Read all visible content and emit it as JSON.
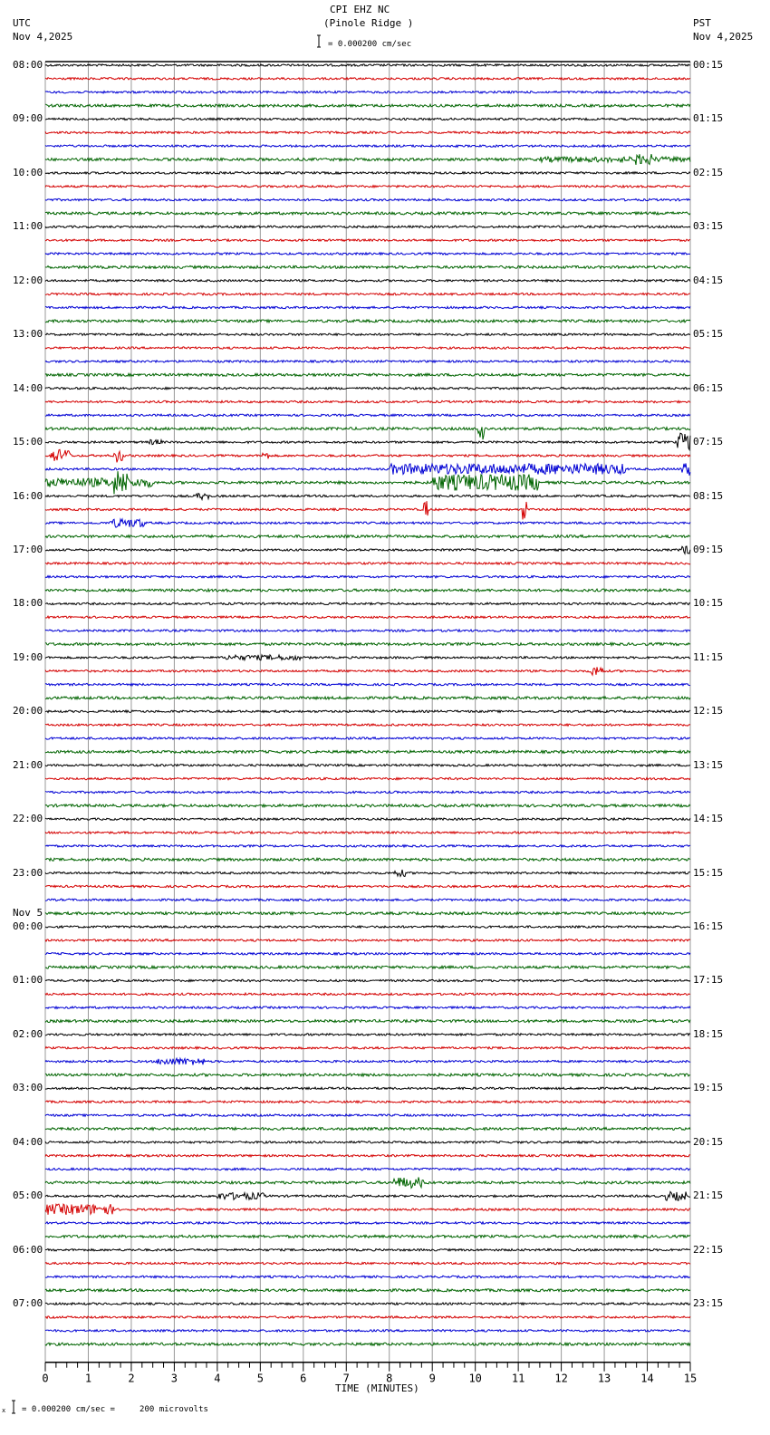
{
  "header": {
    "title": "CPI EHZ NC",
    "station": "(Pinole Ridge )",
    "scale": "= 0.000200 cm/sec",
    "left_zone": "UTC",
    "left_date": "Nov 4,2025",
    "right_zone": "PST",
    "right_date": "Nov 4,2025"
  },
  "footer": {
    "scale": "= 0.000200 cm/sec =     200 microvolts",
    "mark": "x"
  },
  "chart_data": {
    "type": "line",
    "title": "CPI EHZ NC (Pinole Ridge )",
    "xlabel": "TIME (MINUTES)",
    "xlim": [
      0,
      15
    ],
    "x_ticks": [
      "0",
      "1",
      "2",
      "3",
      "4",
      "5",
      "6",
      "7",
      "8",
      "9",
      "10",
      "11",
      "12",
      "13",
      "14",
      "15"
    ],
    "traces_per_hour": 4,
    "trace_colors": [
      "#000000",
      "#d40000",
      "#0000d4",
      "#006400"
    ],
    "left_labels": [
      "08:00",
      "09:00",
      "10:00",
      "11:00",
      "12:00",
      "13:00",
      "14:00",
      "15:00",
      "16:00",
      "17:00",
      "18:00",
      "19:00",
      "20:00",
      "21:00",
      "22:00",
      "23:00",
      "00:00",
      "01:00",
      "02:00",
      "03:00",
      "04:00",
      "05:00",
      "06:00",
      "07:00"
    ],
    "date_change_label": "Nov 5",
    "date_change_index": 16,
    "right_labels": [
      "00:15",
      "01:15",
      "02:15",
      "03:15",
      "04:15",
      "05:15",
      "06:15",
      "07:15",
      "08:15",
      "09:15",
      "10:15",
      "11:15",
      "12:15",
      "13:15",
      "14:15",
      "15:15",
      "16:15",
      "17:15",
      "18:15",
      "19:15",
      "20:15",
      "21:15",
      "22:15",
      "23:15"
    ],
    "events": [
      {
        "trace": 7,
        "start": 11.5,
        "end": 15,
        "amp": 3
      },
      {
        "trace": 7,
        "start": 13.7,
        "end": 14.1,
        "amp": 6
      },
      {
        "trace": 27,
        "start": 10.05,
        "end": 10.2,
        "amp": 18
      },
      {
        "trace": 28,
        "start": 2.4,
        "end": 2.7,
        "amp": 3
      },
      {
        "trace": 28,
        "start": 14.7,
        "end": 15,
        "amp": 10
      },
      {
        "trace": 29,
        "start": 0.1,
        "end": 0.6,
        "amp": 7
      },
      {
        "trace": 29,
        "start": 1.6,
        "end": 1.8,
        "amp": 8
      },
      {
        "trace": 29,
        "start": 5.0,
        "end": 5.2,
        "amp": 4
      },
      {
        "trace": 30,
        "start": 8.0,
        "end": 13.5,
        "amp": 6
      },
      {
        "trace": 30,
        "start": 14.8,
        "end": 15,
        "amp": 8
      },
      {
        "trace": 31,
        "start": 0,
        "end": 2.5,
        "amp": 5
      },
      {
        "trace": 31,
        "start": 1.6,
        "end": 1.9,
        "amp": 14
      },
      {
        "trace": 31,
        "start": 9.0,
        "end": 11.5,
        "amp": 9
      },
      {
        "trace": 32,
        "start": 3.5,
        "end": 3.8,
        "amp": 4
      },
      {
        "trace": 33,
        "start": 8.8,
        "end": 8.9,
        "amp": 10
      },
      {
        "trace": 33,
        "start": 11.1,
        "end": 11.2,
        "amp": 12
      },
      {
        "trace": 34,
        "start": 1.5,
        "end": 2.3,
        "amp": 5
      },
      {
        "trace": 36,
        "start": 14.8,
        "end": 15,
        "amp": 5
      },
      {
        "trace": 44,
        "start": 4.2,
        "end": 6.0,
        "amp": 3
      },
      {
        "trace": 45,
        "start": 12.7,
        "end": 13.0,
        "amp": 6
      },
      {
        "trace": 60,
        "start": 8.1,
        "end": 8.4,
        "amp": 4
      },
      {
        "trace": 74,
        "start": 2.6,
        "end": 3.7,
        "amp": 4
      },
      {
        "trace": 83,
        "start": 8.1,
        "end": 8.8,
        "amp": 6
      },
      {
        "trace": 84,
        "start": 4.0,
        "end": 5.1,
        "amp": 4
      },
      {
        "trace": 84,
        "start": 14.4,
        "end": 14.9,
        "amp": 5
      },
      {
        "trace": 85,
        "start": 0,
        "end": 1.6,
        "amp": 6
      }
    ]
  }
}
